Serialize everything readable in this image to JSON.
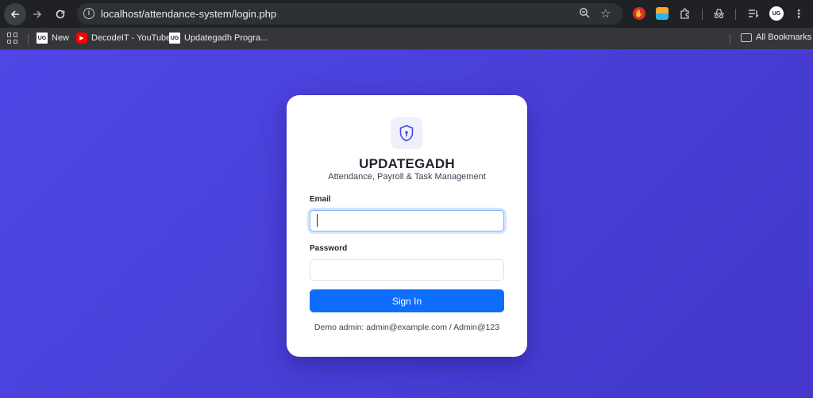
{
  "browser": {
    "url": "localhost/attendance-system/login.php",
    "bookmarks": [
      {
        "label": "New",
        "favicon": "UG"
      },
      {
        "label": "DecodeIT - YouTube",
        "favicon": "youtube"
      },
      {
        "label": "Updategadh Progra...",
        "favicon": "UG"
      }
    ],
    "all_bookmarks_label": "All Bookmarks",
    "profile_initials": "UG"
  },
  "login": {
    "brand": "UPDATEGADH",
    "tagline": "Attendance, Payroll & Task Management",
    "email_label": "Email",
    "email_value": "",
    "password_label": "Password",
    "password_value": "",
    "signin_label": "Sign In",
    "demo_text": "Demo admin: admin@example.com / Admin@123"
  },
  "colors": {
    "background": "#4f46e5",
    "primary_button": "#0d6efd",
    "logo_icon": "#4f46e5"
  }
}
